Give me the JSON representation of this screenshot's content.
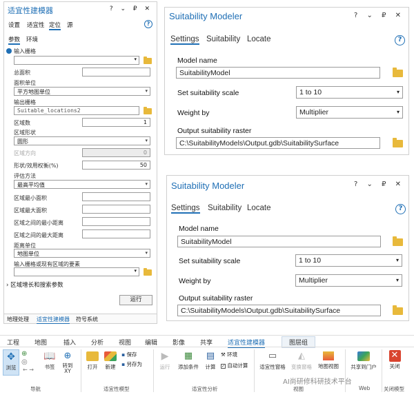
{
  "left_pane": {
    "title": "适宜性建模器",
    "window_controls": "? ⌄ ₽ ✕",
    "tabs": [
      "设置",
      "适宜性",
      "定位",
      "源"
    ],
    "subtabs": [
      "参数",
      "环境"
    ],
    "fields": {
      "input_raster": "输入栅格",
      "total_area": "总面积",
      "area_units": "面积单位",
      "area_units_value": "平方地图单位",
      "output_raster": "输出栅格",
      "output_raster_value": "Suitable_locations2",
      "num_regions": "区域数",
      "num_regions_value": "1",
      "region_shape": "区域形状",
      "region_shape_value": "圆形",
      "region_orientation": "区域方向",
      "region_orientation_value": "0",
      "shape_weight": "形状/效用权衡(%)",
      "shape_weight_value": "50",
      "eval_method": "评估方法",
      "eval_method_value": "最高平均值",
      "min_area": "区域最小面积",
      "max_area": "区域最大面积",
      "min_dist": "区域之间的最小距离",
      "max_dist": "区域之间的最大距离",
      "dist_units": "距离单位",
      "dist_units_value": "地图单位",
      "existing_regions": "输入栅格或现有区域的要素",
      "growth_params": "区域增长和搜索参数"
    },
    "run_button": "运行",
    "bottom_tabs": [
      "地理处理",
      "适宜性建模器",
      "符号系统"
    ]
  },
  "pane1": {
    "title": "Suitability Modeler",
    "controls": "? ⌄ ₽ ✕",
    "tabs": [
      "Settings",
      "Suitability",
      "Locate"
    ],
    "model_name_label": "Model name",
    "model_name_value": "SuitabilityModel",
    "scale_label": "Set suitability scale",
    "scale_value": "1 to 10",
    "weight_label": "Weight by",
    "weight_value": "Multiplier",
    "raster_label": "Output suitability raster",
    "raster_value": "C:\\SuitabilityModels\\Output.gdb\\SuitabilitySurface"
  },
  "pane2": {
    "title": "Suitability Modeler",
    "controls": "? ⌄ ₽ ✕",
    "tabs": [
      "Settings",
      "Suitability",
      "Locate"
    ],
    "model_name_label": "Model name",
    "model_name_value": "SuitabilityModel",
    "scale_label": "Set suitability scale",
    "scale_value": "1 to 10",
    "weight_label": "Weight by",
    "weight_value": "Multiplier",
    "raster_label": "Output suitability raster",
    "raster_value": "C:\\SuitabilityModels\\Output.gdb\\SuitabilitySurface"
  },
  "ribbon": {
    "tabs": [
      "工程",
      "地图",
      "插入",
      "分析",
      "视图",
      "编辑",
      "影像",
      "共享",
      "适宜性建模器",
      "图层组"
    ],
    "buttons": {
      "explore": "浏览",
      "bookmarks": "书签",
      "goto_xy": "转到\nXY",
      "open": "打开",
      "new": "新建",
      "save": "保存",
      "save_as": "另存为",
      "run": "运行",
      "add_criteria": "添加条件",
      "calculate": "计算",
      "environment": "环境",
      "auto_calc": "自动计算",
      "suit_pane": "适宜性窗格",
      "transform_pane": "变换窗格",
      "map_view": "地图视图",
      "share_portal": "共享到门户",
      "close": "关闭"
    },
    "groups": [
      "导航",
      "适宜性模型",
      "适宜性分析",
      "视图",
      "Web",
      "关闭模型"
    ]
  },
  "watermark": "AI尚研修科研技术平台"
}
